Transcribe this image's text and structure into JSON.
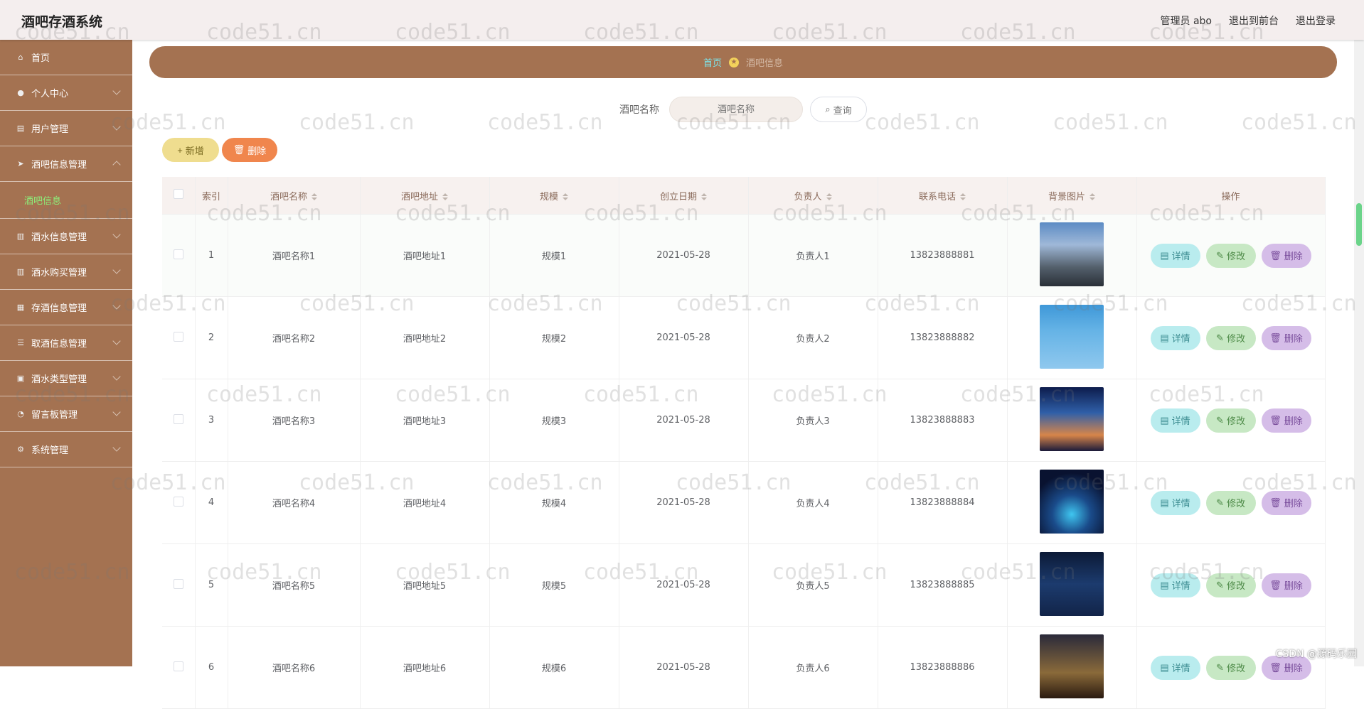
{
  "header": {
    "title": "酒吧存酒系统",
    "admin": "管理员 abo",
    "to_front": "退出到前台",
    "logout": "退出登录"
  },
  "sidebar": {
    "items": [
      {
        "label": "首页",
        "icon": "home-icon"
      },
      {
        "label": "个人中心",
        "icon": "user-icon"
      },
      {
        "label": "用户管理",
        "icon": "users-icon"
      },
      {
        "label": "酒吧信息管理",
        "icon": "send-icon"
      },
      {
        "label": "酒吧信息",
        "icon": ""
      },
      {
        "label": "酒水信息管理",
        "icon": "bank-icon"
      },
      {
        "label": "酒水购买管理",
        "icon": "bank-icon"
      },
      {
        "label": "存酒信息管理",
        "icon": "list-icon"
      },
      {
        "label": "取酒信息管理",
        "icon": "menu-icon"
      },
      {
        "label": "酒水类型管理",
        "icon": "grid-icon"
      },
      {
        "label": "留言板管理",
        "icon": "chat-icon"
      },
      {
        "label": "系统管理",
        "icon": "settings-icon"
      }
    ]
  },
  "breadcrumb": {
    "home": "首页",
    "current": "酒吧信息"
  },
  "search": {
    "label": "酒吧名称",
    "placeholder": "酒吧名称",
    "query_label": "查询"
  },
  "actions": {
    "add_label": "新增",
    "delete_label": "删除"
  },
  "table": {
    "columns": [
      "索引",
      "酒吧名称",
      "酒吧地址",
      "规模",
      "创立日期",
      "负责人",
      "联系电话",
      "背景图片",
      "操作"
    ],
    "rows": [
      {
        "index": "1",
        "name": "酒吧名称1",
        "address": "酒吧地址1",
        "scale": "规模1",
        "date": "2021-05-28",
        "manager": "负责人1",
        "phone": "13823888881"
      },
      {
        "index": "2",
        "name": "酒吧名称2",
        "address": "酒吧地址2",
        "scale": "规模2",
        "date": "2021-05-28",
        "manager": "负责人2",
        "phone": "13823888882"
      },
      {
        "index": "3",
        "name": "酒吧名称3",
        "address": "酒吧地址3",
        "scale": "规模3",
        "date": "2021-05-28",
        "manager": "负责人3",
        "phone": "13823888883"
      },
      {
        "index": "4",
        "name": "酒吧名称4",
        "address": "酒吧地址4",
        "scale": "规模4",
        "date": "2021-05-28",
        "manager": "负责人4",
        "phone": "13823888884"
      },
      {
        "index": "5",
        "name": "酒吧名称5",
        "address": "酒吧地址5",
        "scale": "规模5",
        "date": "2021-05-28",
        "manager": "负责人5",
        "phone": "13823888885"
      },
      {
        "index": "6",
        "name": "酒吧名称6",
        "address": "酒吧地址6",
        "scale": "规模6",
        "date": "2021-05-28",
        "manager": "负责人6",
        "phone": "13823888886"
      }
    ],
    "op_detail": "详情",
    "op_edit": "修改",
    "op_delete": "删除"
  },
  "watermark": "code51.cn",
  "csdn": "CSDN @源码乐园",
  "colors": {
    "sidebar": "#a47251",
    "active_sub": "#8cf07a",
    "header_bg": "#f4eeee"
  }
}
